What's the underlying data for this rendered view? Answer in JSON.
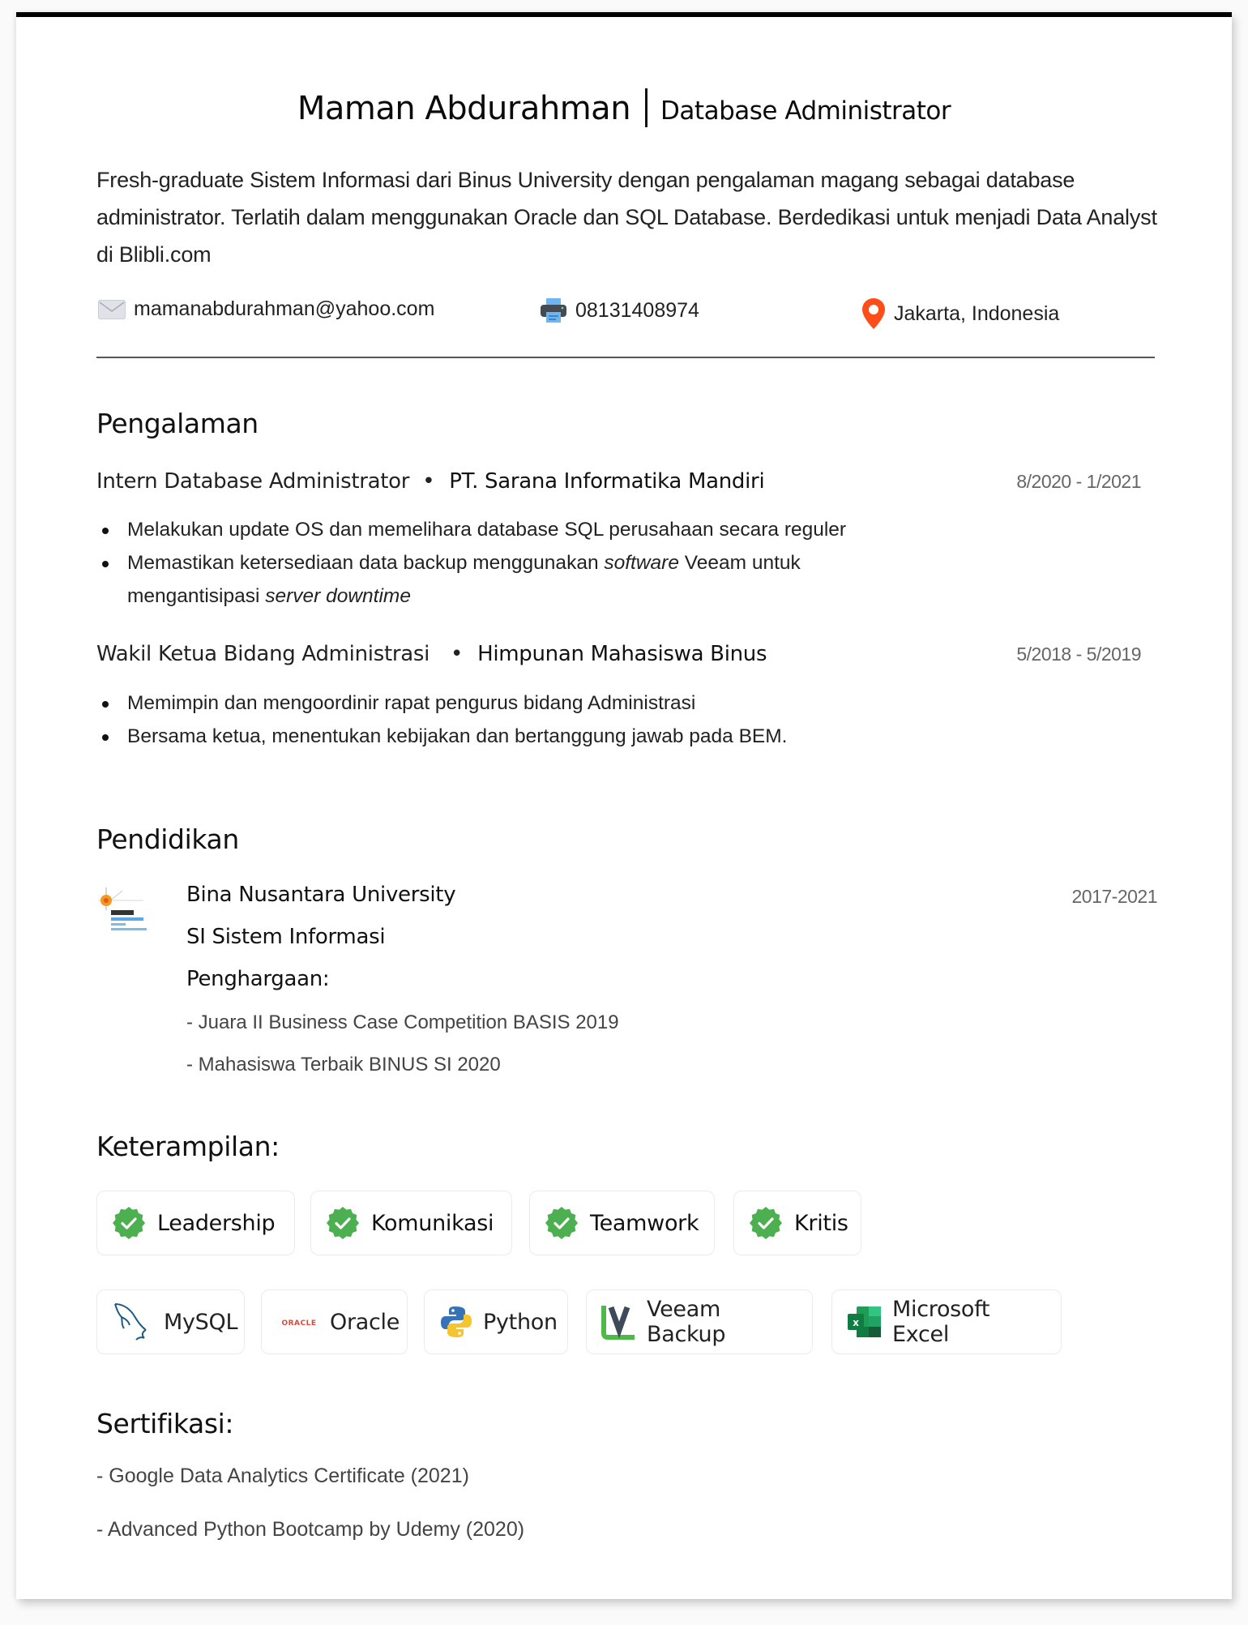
{
  "header": {
    "name": "Maman Abdurahman",
    "role": "Database Administrator",
    "summary": "Fresh-graduate Sistem Informasi dari Binus University dengan pengalaman magang sebagai database administrator. Terlatih dalam menggunakan Oracle dan SQL Database. Berdedikasi untuk menjadi Data Analyst di Blibli.com"
  },
  "contact": {
    "email": {
      "icon": "mail-icon",
      "value": "mamanabdurahman@yahoo.com"
    },
    "phone": {
      "icon": "printer-icon",
      "value": "08131408974"
    },
    "location": {
      "icon": "map-pin-icon",
      "value": "Jakarta, Indonesia",
      "color": "#FF4D1A"
    }
  },
  "experience": {
    "heading": "Pengalaman",
    "jobs": [
      {
        "title": "Intern Database Administrator",
        "separator": "•",
        "org": "PT. Sarana Informatika Mandiri",
        "date": "8/2020 - 1/2021",
        "bullets": [
          {
            "parts": [
              {
                "t": "Melakukan update OS dan memelihara database SQL perusahaan secara reguler",
                "i": false
              }
            ]
          },
          {
            "parts": [
              {
                "t": "Memastikan ketersediaan data backup menggunakan ",
                "i": false
              },
              {
                "t": "software",
                "i": true
              },
              {
                "t": " Veeam untuk mengantisipasi ",
                "i": false
              },
              {
                "t": "server downtime",
                "i": true
              }
            ]
          }
        ]
      },
      {
        "title": "Wakil Ketua Bidang Administrasi",
        "separator": "•",
        "org": "Himpunan Mahasiswa Binus",
        "date": "5/2018 - 5/2019",
        "bullets": [
          {
            "parts": [
              {
                "t": "Memimpin dan mengoordinir rapat pengurus bidang Administrasi",
                "i": false
              }
            ]
          },
          {
            "parts": [
              {
                "t": "Bersama ketua, menentukan kebijakan dan bertanggung jawab pada BEM.",
                "i": false
              }
            ]
          }
        ]
      }
    ]
  },
  "education": {
    "heading": "Pendidikan",
    "logo": "binus-university-logo",
    "school": "Bina Nusantara University",
    "degree": "SI Sistem Informasi",
    "awards_label": "Penghargaan:",
    "awards": [
      "- Juara II Business Case Competition BASIS 2019",
      "- Mahasiswa Terbaik BINUS SI 2020"
    ],
    "date": "2017-2021"
  },
  "skills": {
    "heading": "Keterampilan:",
    "soft": [
      {
        "label": "Leadership",
        "icon": "verified-check-icon"
      },
      {
        "label": "Komunikasi",
        "icon": "verified-check-icon"
      },
      {
        "label": "Teamwork",
        "icon": "verified-check-icon"
      },
      {
        "label": "Kritis",
        "icon": "verified-check-icon"
      }
    ],
    "soft_icon_color": "#4CAF50",
    "tech": [
      {
        "label": "MySQL",
        "icon": "mysql-dolphin-icon"
      },
      {
        "label": "Oracle",
        "icon": "oracle-logo-icon",
        "icon_text": "ORACLE"
      },
      {
        "label": "Python",
        "icon": "python-logo-icon"
      },
      {
        "label": "Veeam Backup",
        "icon": "veeam-logo-icon"
      },
      {
        "label": "Microsoft Excel",
        "icon": "excel-logo-icon"
      }
    ]
  },
  "certifications": {
    "heading": "Sertifikasi:",
    "items": [
      "- Google Data Analytics Certificate (2021)",
      "- Advanced Python Bootcamp by Udemy (2020)"
    ]
  }
}
